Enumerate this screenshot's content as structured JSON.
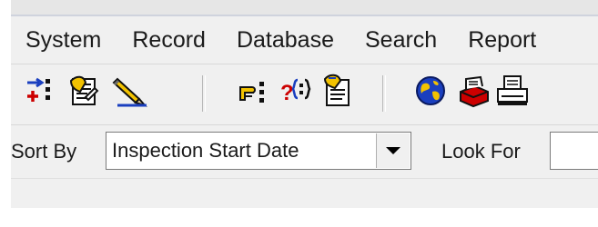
{
  "menu": {
    "items": [
      {
        "label": "System"
      },
      {
        "label": "Record"
      },
      {
        "label": "Database"
      },
      {
        "label": "Search"
      },
      {
        "label": "Report"
      }
    ]
  },
  "toolbar": {
    "buttons": [
      {
        "icon": "insert-record-icon"
      },
      {
        "icon": "edit-document-icon"
      },
      {
        "icon": "pencil-icon"
      },
      {
        "icon": "pointing-hand-icon"
      },
      {
        "icon": "query-icon"
      },
      {
        "icon": "notes-icon"
      },
      {
        "icon": "globe-icon"
      },
      {
        "icon": "print-preview-icon"
      },
      {
        "icon": "printer-icon"
      }
    ]
  },
  "sortbar": {
    "sort_label": "Sort By",
    "sort_value": "Inspection Start Date",
    "look_label": "Look For",
    "look_value": ""
  },
  "colors": {
    "bar": "#f0f0f0",
    "accent_red": "#cc0000",
    "accent_blue": "#1a3fbf",
    "accent_yellow": "#f2c200"
  }
}
